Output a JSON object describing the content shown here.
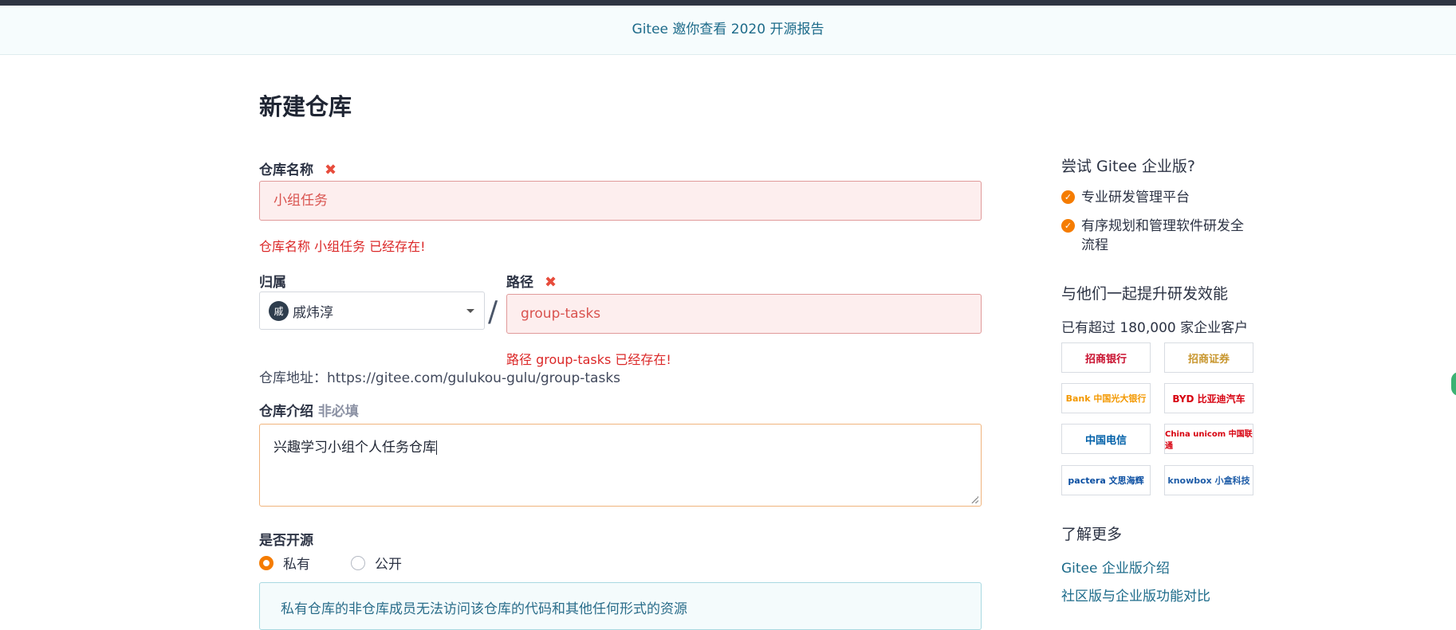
{
  "banner": {
    "text": "Gitee 邀你查看 2020 开源报告"
  },
  "page": {
    "title": "新建仓库"
  },
  "form": {
    "name_label": "仓库名称",
    "required_mark": "✖",
    "name_value": "小组任务",
    "name_error": "仓库名称 小组任务 已经存在!",
    "owner_label": "归属",
    "owner_avatar_text": "戚",
    "owner_name": "戚炜淳",
    "slash": "/",
    "path_label": "路径",
    "path_value": "group-tasks",
    "path_error": "路径 group-tasks 已经存在!",
    "address_text": "仓库地址：https://gitee.com/gulukou-gulu/group-tasks",
    "desc_label": "仓库介绍",
    "desc_optional": "非必填",
    "desc_value": "兴趣学习小组个人任务仓库",
    "visibility_label": "是否开源",
    "visibility_options": [
      {
        "label": "私有",
        "selected": true
      },
      {
        "label": "公开",
        "selected": false
      }
    ],
    "private_note": "私有仓库的非仓库成员无法访问该仓库的代码和其他任何形式的资源"
  },
  "sidebar": {
    "enterprise_title": "尝试 Gitee 企业版?",
    "features": [
      "专业研发管理平台",
      "有序规划和管理软件研发全流程"
    ],
    "clients_title": "与他们一起提升研发效能",
    "clients_note": "已有超过 180,000 家企业客户",
    "logos": [
      {
        "name": "招商银行",
        "color": "#c8102e"
      },
      {
        "name": "招商证券",
        "color": "#c8962e"
      },
      {
        "name": "Bank 中国光大银行",
        "color": "#f39800"
      },
      {
        "name": "BYD 比亚迪汽车",
        "color": "#d7000f"
      },
      {
        "name": "中国电信",
        "color": "#0060a8"
      },
      {
        "name": "China unicom 中国联通",
        "color": "#d7000f"
      },
      {
        "name": "pactera 文思海辉",
        "color": "#0a4ea1"
      },
      {
        "name": "knowbox 小盒科技",
        "color": "#1f5da8"
      }
    ],
    "learn_more_title": "了解更多",
    "links": [
      "Gitee 企业版介绍",
      "社区版与企业版功能对比"
    ]
  }
}
